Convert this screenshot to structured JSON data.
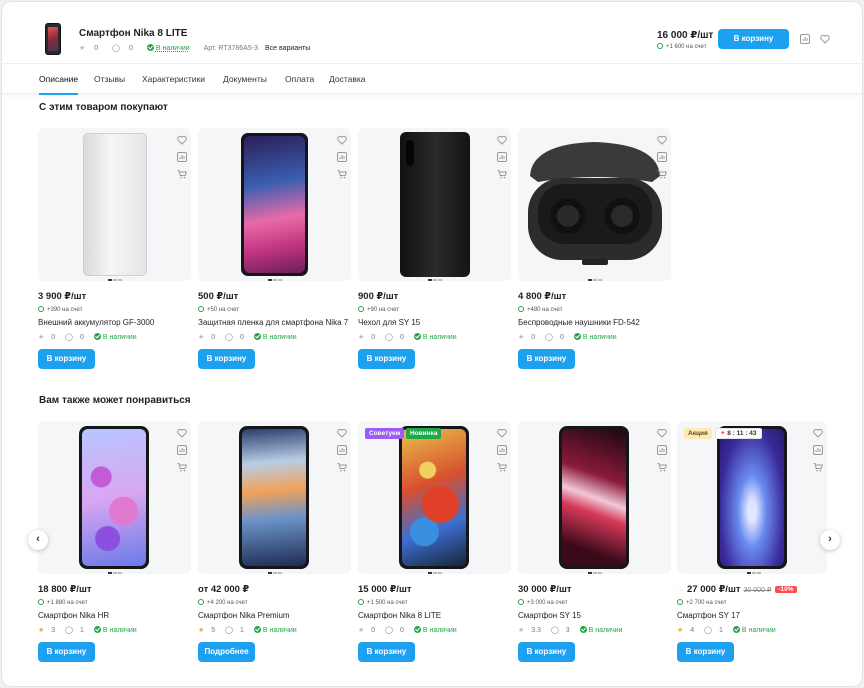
{
  "product": {
    "title": "Смартфон Nika 8 LITE",
    "rating": "0",
    "reviews": "0",
    "stock": "В наличии",
    "sku": "Арт. RT3786A5-3",
    "variants": "Все варианты",
    "price": "16 000 ₽/шт",
    "bonus": "+1 600 на счет",
    "cart_label": "В корзину"
  },
  "tabs": [
    "Описание",
    "Отзывы",
    "Характеристики",
    "Документы",
    "Оплата",
    "Доставка"
  ],
  "section1": {
    "title": "С этим товаром покупают",
    "items": [
      {
        "price": "3 900 ₽/шт",
        "bonus": "+390 на счет",
        "name": "Внешний аккумулятор GF-3000",
        "rating": "0",
        "reviews": "0",
        "stock": "В наличии",
        "button": "В корзину"
      },
      {
        "price": "500 ₽/шт",
        "bonus": "+50 на счет",
        "name": "Защитная пленка для смартфона Nika 7",
        "rating": "0",
        "reviews": "0",
        "stock": "В наличии",
        "button": "В корзину"
      },
      {
        "price": "900 ₽/шт",
        "bonus": "+90 на счет",
        "name": "Чехол для SY 15",
        "rating": "0",
        "reviews": "0",
        "stock": "В наличии",
        "button": "В корзину"
      },
      {
        "price": "4 800 ₽/шт",
        "bonus": "+480 на счет",
        "name": "Беспроводные наушники FD-542",
        "rating": "0",
        "reviews": "0",
        "stock": "В наличии",
        "button": "В корзину"
      }
    ]
  },
  "section2": {
    "title": "Вам также может понравиться",
    "items": [
      {
        "price": "18 800 ₽/шт",
        "bonus": "+1 880 на счет",
        "name": "Смартфон Nika HR",
        "rating": "3",
        "reviews": "1",
        "stock": "В наличии",
        "button": "В корзину"
      },
      {
        "price": "от 42 000 ₽",
        "bonus": "+4 200 на счет",
        "name": "Смартфон Nika Premium",
        "rating": "5",
        "reviews": "1",
        "stock": "В наличии",
        "button": "Подробнее"
      },
      {
        "price": "15 000 ₽/шт",
        "bonus": "+1 500 на счет",
        "name": "Смартфон Nika 8 LITE",
        "rating": "0",
        "reviews": "0",
        "stock": "В наличии",
        "button": "В корзину",
        "badges": [
          "Советуем",
          "Новинка"
        ]
      },
      {
        "price": "30 000 ₽/шт",
        "bonus": "+3 000 на счет",
        "name": "Смартфон SY 15",
        "rating": "3.3",
        "reviews": "3",
        "stock": "В наличии",
        "button": "В корзину"
      },
      {
        "price": "27 000 ₽/шт",
        "old_price": "30 000 ₽",
        "discount": "-10%",
        "bonus": "+2 700 на счет",
        "name": "Смартфон SY 17",
        "rating": "4",
        "reviews": "1",
        "stock": "В наличии",
        "button": "В корзину",
        "badges": [
          "Акция"
        ],
        "timer": "8 : 11 : 43"
      }
    ]
  },
  "colors": {
    "accent": "#1ea0f0",
    "stock": "#23a64a",
    "badge_recommend": "#9b5cf6",
    "badge_new": "#23a64a",
    "badge_sale": "#ffe9b5",
    "discount": "#ff4b4b"
  }
}
